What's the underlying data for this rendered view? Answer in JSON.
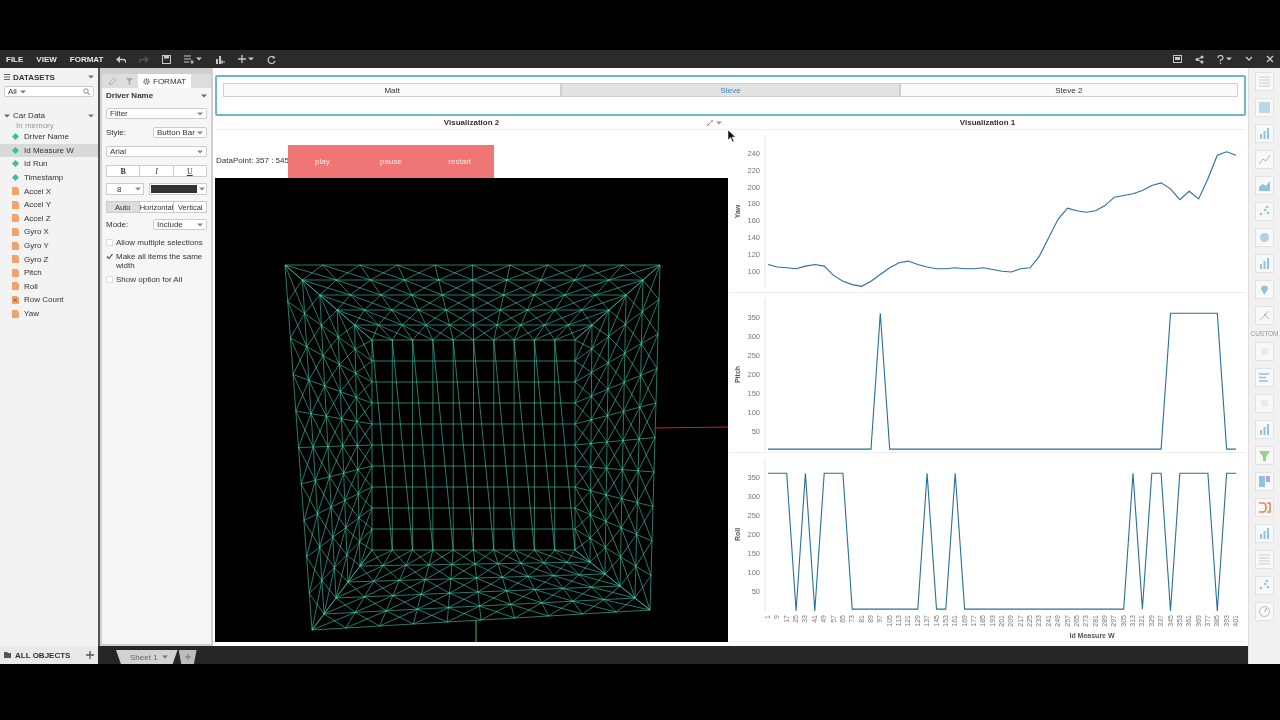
{
  "menu": [
    {
      "label": "FILE"
    },
    {
      "label": "VIEW"
    },
    {
      "label": "FORMAT"
    }
  ],
  "datasets": {
    "title": "DATASETS",
    "filter": "All",
    "source": {
      "name": "Car Data",
      "status": "In memory",
      "expanded": true
    },
    "fields": [
      {
        "name": "Driver Name",
        "kind": "dimension",
        "selected": false
      },
      {
        "name": "Id Measure W",
        "kind": "dimension",
        "selected": true
      },
      {
        "name": "Id Run",
        "kind": "dimension",
        "selected": false
      },
      {
        "name": "Timestamp",
        "kind": "dimension",
        "selected": false
      },
      {
        "name": "Accel X",
        "kind": "measure",
        "selected": false
      },
      {
        "name": "Accel Y",
        "kind": "measure",
        "selected": false
      },
      {
        "name": "Accel Z",
        "kind": "measure",
        "selected": false
      },
      {
        "name": "Gyro X",
        "kind": "measure",
        "selected": false
      },
      {
        "name": "Gyro Y",
        "kind": "measure",
        "selected": false
      },
      {
        "name": "Gyro Z",
        "kind": "measure",
        "selected": false
      },
      {
        "name": "Pitch",
        "kind": "measure",
        "selected": false
      },
      {
        "name": "Roll",
        "kind": "measure",
        "selected": false
      },
      {
        "name": "Row Count",
        "kind": "count",
        "selected": false
      },
      {
        "name": "Yaw",
        "kind": "measure",
        "selected": false
      }
    ]
  },
  "format_panel": {
    "tabs": [
      {
        "kind": "edit",
        "selected": false
      },
      {
        "kind": "filter",
        "selected": false
      },
      {
        "kind": "format",
        "label": "FORMAT",
        "selected": true
      }
    ],
    "field": "Driver Name",
    "control": "Filter",
    "style_label": "Style:",
    "style": "Button Bar",
    "font": "Arial",
    "text_styles": [
      {
        "label": "B",
        "kind": "bold"
      },
      {
        "label": "I",
        "kind": "italic"
      },
      {
        "label": "U",
        "kind": "underline"
      }
    ],
    "font_size": "8",
    "color": "#333333",
    "alignments": [
      {
        "label": "Auto",
        "selected": true
      },
      {
        "label": "Horizontal",
        "selected": false
      },
      {
        "label": "Vertical",
        "selected": false
      }
    ],
    "mode_label": "Mode:",
    "mode": "Include",
    "options": [
      {
        "label": "Allow multiple selections",
        "checked": false
      },
      {
        "label": "Make all items the same width",
        "checked": true
      },
      {
        "label": "Show option for All",
        "checked": false
      }
    ]
  },
  "button_bar": [
    {
      "label": "Matt",
      "selected": false
    },
    {
      "label": "Steve",
      "selected": true
    },
    {
      "label": "Steve 2",
      "selected": false
    }
  ],
  "visualization_2": {
    "title": "Visualization 2",
    "datapoint": "DataPoint: 357 : 545",
    "controls": [
      {
        "label": "play"
      },
      {
        "label": "pause"
      },
      {
        "label": "restart"
      }
    ]
  },
  "visualization_1": {
    "title": "Visualization 1",
    "charts": [
      {
        "chart_data": {
          "type": "line",
          "ylabel": "Yaw",
          "ylim": [
            80,
            262
          ],
          "yticks": [
            100,
            120,
            140,
            160,
            180,
            200,
            220,
            240
          ],
          "series": [
            {
              "color": "#2a6f9b",
              "values": [
                108,
                105,
                104,
                103,
                106,
                108,
                106,
                95,
                88,
                84,
                82,
                88,
                96,
                104,
                110,
                112,
                108,
                105,
                103,
                103,
                104,
                103,
                103,
                104,
                102,
                100,
                99,
                103,
                104,
                118,
                140,
                162,
                175,
                172,
                170,
                172,
                178,
                188,
                190,
                192,
                196,
                202,
                205,
                198,
                185,
                195,
                186,
                210,
                238,
                242,
                238
              ]
            }
          ]
        }
      },
      {
        "chart_data": {
          "type": "line",
          "ylabel": "Pitch",
          "ylim": [
            0,
            400
          ],
          "yticks": [
            50,
            100,
            150,
            200,
            250,
            300,
            350
          ],
          "series": [
            {
              "color": "#2a6f9b",
              "values": [
                5,
                5,
                5,
                5,
                5,
                5,
                5,
                5,
                5,
                5,
                5,
                5,
                360,
                5,
                5,
                5,
                5,
                5,
                5,
                5,
                5,
                5,
                5,
                5,
                5,
                5,
                5,
                5,
                5,
                5,
                5,
                5,
                5,
                5,
                5,
                5,
                5,
                5,
                5,
                5,
                5,
                5,
                5,
                360,
                360,
                360,
                360,
                360,
                360,
                5,
                5
              ]
            }
          ]
        }
      },
      {
        "chart_data": {
          "type": "line",
          "xlabel": "Id Measure W",
          "ylabel": "Roll",
          "ylim": [
            0,
            400
          ],
          "yticks": [
            50,
            100,
            150,
            200,
            250,
            300,
            350
          ],
          "categories": [
            "1",
            "9",
            "17",
            "25",
            "33",
            "41",
            "49",
            "57",
            "65",
            "73",
            "81",
            "89",
            "97",
            "105",
            "113",
            "121",
            "129",
            "137",
            "145",
            "153",
            "161",
            "169",
            "177",
            "185",
            "193",
            "201",
            "209",
            "217",
            "225",
            "233",
            "241",
            "249",
            "257",
            "265",
            "273",
            "281",
            "289",
            "297",
            "305",
            "313",
            "321",
            "329",
            "337",
            "345",
            "353",
            "361",
            "369",
            "377",
            "385",
            "393",
            "401"
          ],
          "series": [
            {
              "color": "#2a6f9b",
              "values": [
                360,
                360,
                360,
                0,
                360,
                0,
                360,
                360,
                360,
                5,
                5,
                5,
                5,
                5,
                5,
                5,
                5,
                360,
                5,
                5,
                360,
                5,
                5,
                5,
                5,
                5,
                5,
                5,
                5,
                5,
                5,
                5,
                5,
                5,
                5,
                5,
                5,
                5,
                5,
                360,
                5,
                360,
                360,
                0,
                360,
                360,
                360,
                360,
                0,
                360,
                360
              ]
            }
          ]
        }
      }
    ]
  },
  "gallery": {
    "section": "CUSTOM"
  },
  "bottom": {
    "objects": "ALL OBJECTS",
    "sheets": [
      {
        "label": "Sheet 1",
        "selected": true
      }
    ]
  }
}
